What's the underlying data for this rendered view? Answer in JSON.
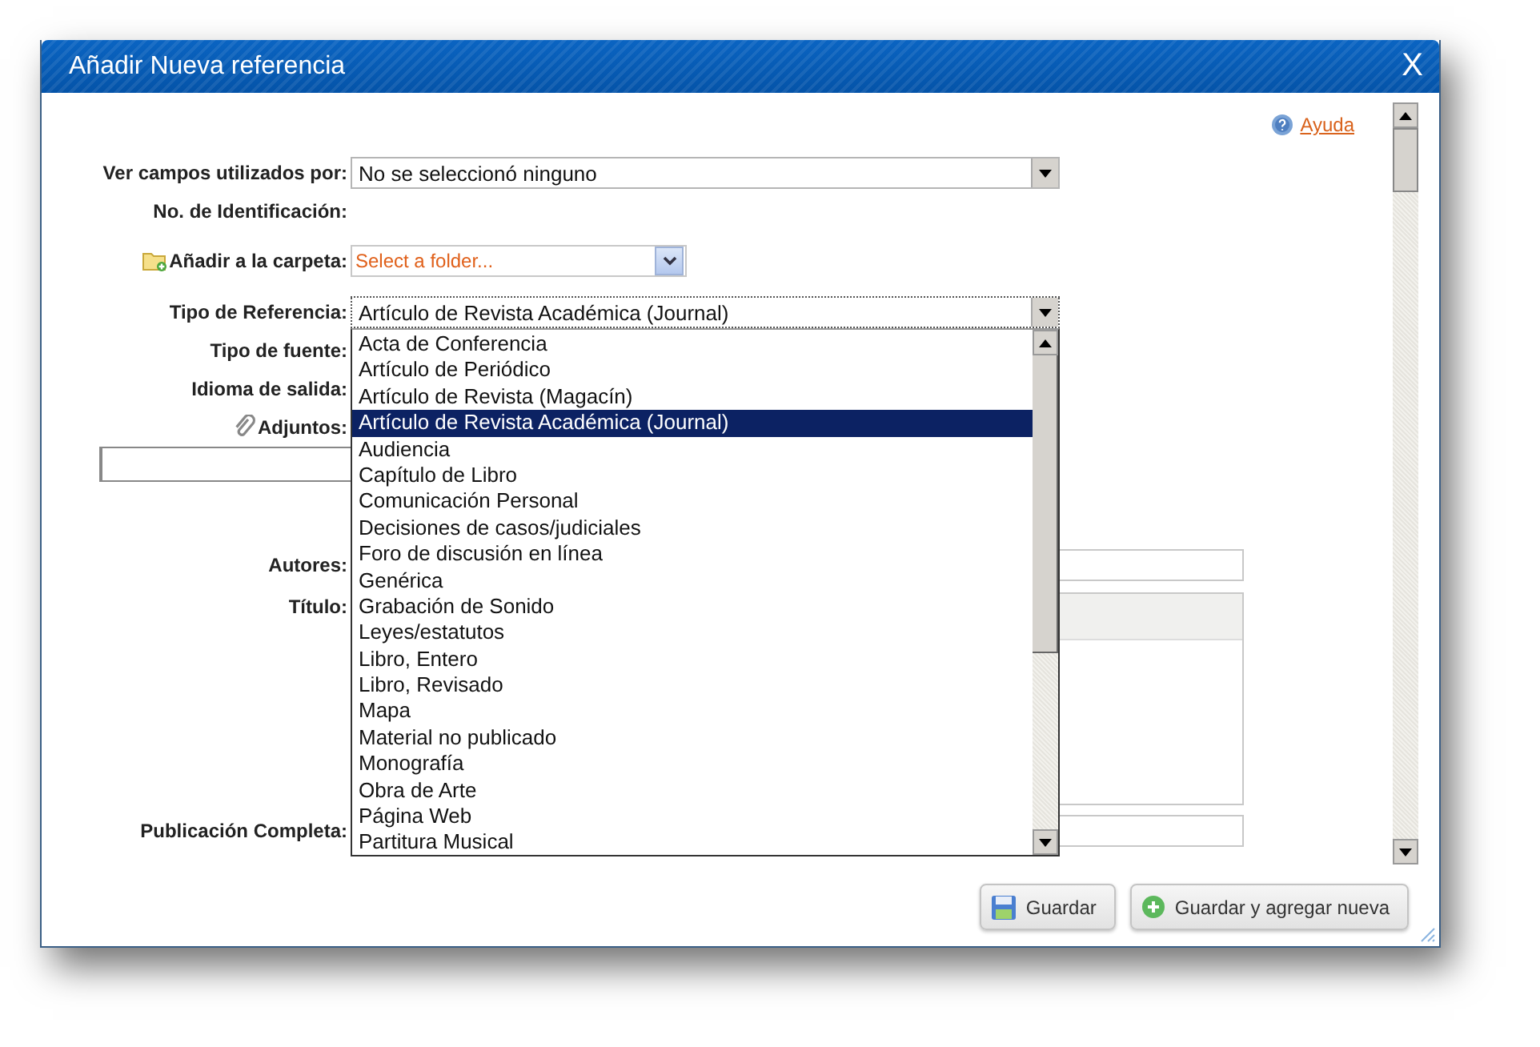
{
  "dialog": {
    "title": "Añadir Nueva referencia",
    "close": "X",
    "help_link": "Ayuda",
    "fields": [
      {
        "kind": "select",
        "label": "Ver campos utilizados por:",
        "value": "No se seleccionó ninguno"
      },
      {
        "kind": "static",
        "label": "No. de Identificación:"
      },
      {
        "kind": "folder",
        "label": "Añadir a la carpeta:",
        "placeholder": "Select a folder..."
      },
      {
        "kind": "select",
        "label": "Tipo de Referencia:",
        "value": "Artículo de Revista Académica (Journal)",
        "expanded": true
      },
      {
        "kind": "static",
        "label": "Tipo de fuente:"
      },
      {
        "kind": "static",
        "label": "Idioma de salida:"
      },
      {
        "kind": "attach",
        "label": "Adjuntos:"
      },
      {
        "kind": "text",
        "label": "Autores:"
      },
      {
        "kind": "textarea",
        "label": "Título:"
      },
      {
        "kind": "text",
        "label": "Publicación Completa:"
      }
    ],
    "reference_type_options": [
      {
        "label": "Acta de Conferencia",
        "selected": false
      },
      {
        "label": "Artículo de Periódico",
        "selected": false
      },
      {
        "label": "Artículo de Revista (Magacín)",
        "selected": false
      },
      {
        "label": "Artículo de Revista Académica (Journal)",
        "selected": true
      },
      {
        "label": "Audiencia",
        "selected": false
      },
      {
        "label": "Capítulo de Libro",
        "selected": false
      },
      {
        "label": "Comunicación Personal",
        "selected": false
      },
      {
        "label": "Decisiones de casos/judiciales",
        "selected": false
      },
      {
        "label": "Foro de discusión en línea",
        "selected": false
      },
      {
        "label": "Genérica",
        "selected": false
      },
      {
        "label": "Grabación de Sonido",
        "selected": false
      },
      {
        "label": "Leyes/estatutos",
        "selected": false
      },
      {
        "label": "Libro, Entero",
        "selected": false
      },
      {
        "label": "Libro, Revisado",
        "selected": false
      },
      {
        "label": "Mapa",
        "selected": false
      },
      {
        "label": "Material no publicado",
        "selected": false
      },
      {
        "label": "Monografía",
        "selected": false
      },
      {
        "label": "Obra de Arte",
        "selected": false
      },
      {
        "label": "Página Web",
        "selected": false
      },
      {
        "label": "Partitura Musical",
        "selected": false
      }
    ],
    "buttons": [
      {
        "kind": "save",
        "label": "Guardar"
      },
      {
        "kind": "add",
        "label": "Guardar y agregar nueva"
      }
    ]
  }
}
